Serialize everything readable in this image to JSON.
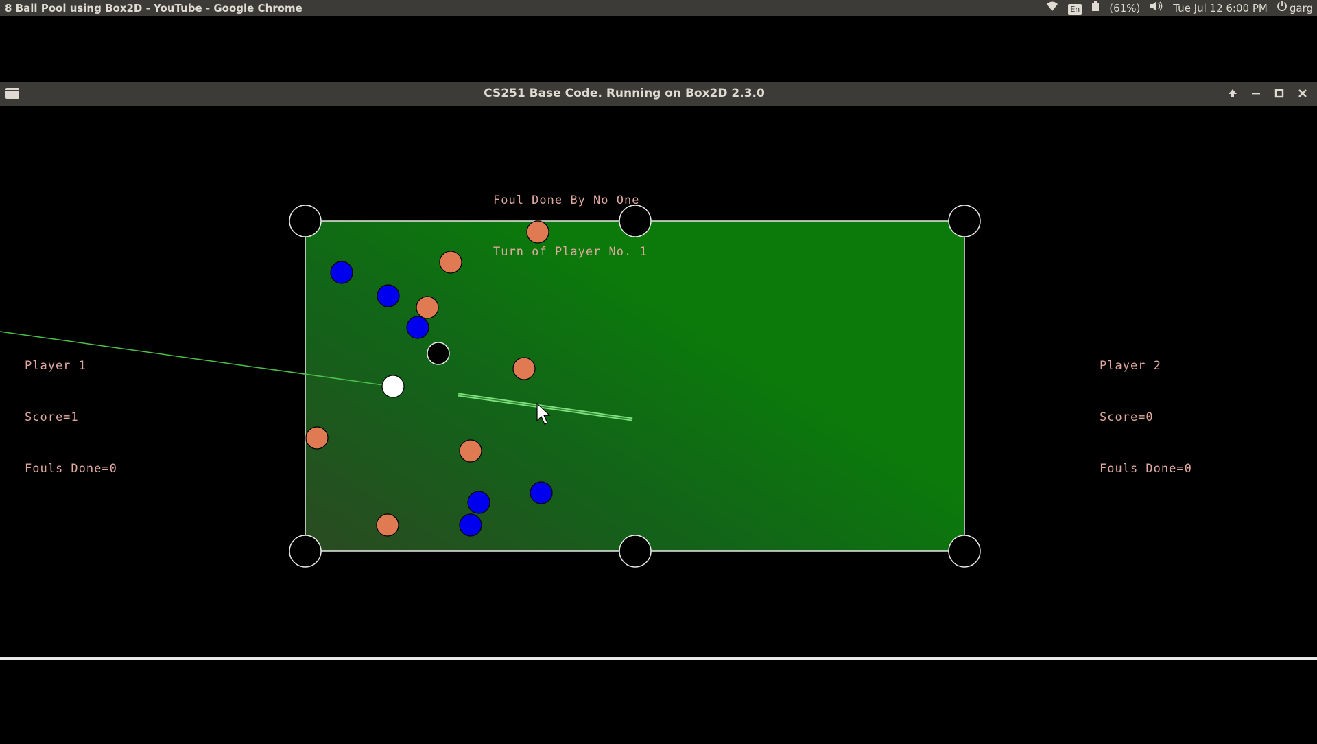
{
  "system_bar": {
    "window_title": "8 Ball Pool using Box2D - YouTube - Google Chrome",
    "icons": [
      "wifi-icon",
      "keyboard-layout-icon",
      "battery-icon",
      "volume-icon",
      "power-icon"
    ],
    "keyboard_layout": "En",
    "battery": "(61%)",
    "clock": "Tue Jul 12  6:00 PM",
    "user": "garg"
  },
  "app_window": {
    "title": "CS251 Base Code. Running on Box2D 2.3.0",
    "controls": [
      "up-arrow-icon",
      "minimize-icon",
      "maximize-icon",
      "close-icon"
    ]
  },
  "game": {
    "status_line_1": "Foul Done By No One",
    "status_line_2": "Turn of Player No. 1",
    "player1": {
      "name": "Player 1",
      "score": "Score=1",
      "fouls": "Fouls Done=0"
    },
    "player2": {
      "name": "Player 2",
      "score": "Score=0",
      "fouls": "Fouls Done=0"
    },
    "colors": {
      "table_felt": "#0b7a0b",
      "felt_shadow": "#2b4a22",
      "solid_ball": "#e07a52",
      "stripe_ball": "#0000ee",
      "cue_ball": "#ffffff",
      "eight_ball": "#000000",
      "cue_stick": "#7fe07f",
      "hud_text": "#e0a9a0"
    },
    "balls": [
      {
        "type": "solid"
      },
      {
        "type": "solid"
      },
      {
        "type": "solid"
      },
      {
        "type": "solid"
      },
      {
        "type": "solid"
      },
      {
        "type": "solid"
      },
      {
        "type": "solid"
      },
      {
        "type": "stripe"
      },
      {
        "type": "stripe"
      },
      {
        "type": "stripe"
      },
      {
        "type": "stripe"
      },
      {
        "type": "stripe"
      },
      {
        "type": "stripe"
      },
      {
        "type": "stripe"
      },
      {
        "type": "eight"
      },
      {
        "type": "cue"
      }
    ],
    "pocket_count": 6
  }
}
